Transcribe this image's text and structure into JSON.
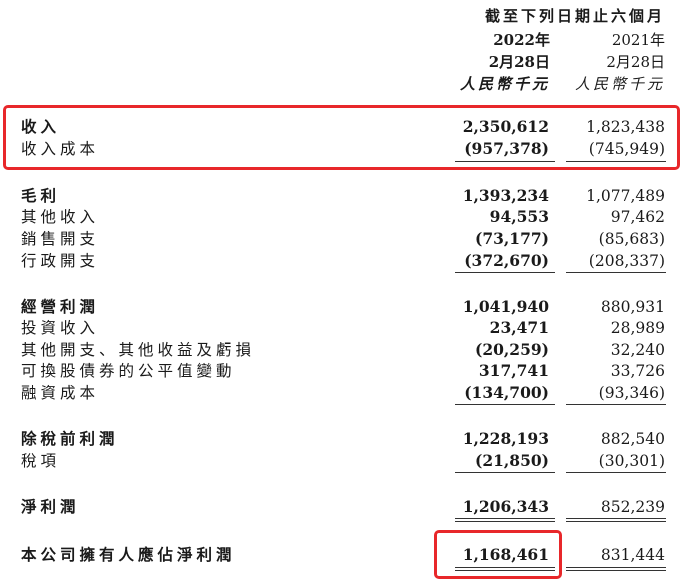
{
  "header": {
    "period": "截至下列日期止六個月",
    "col1": {
      "year": "2022年",
      "date": "2月28日",
      "unit": "人民幣千元"
    },
    "col2": {
      "year": "2021年",
      "date": "2月28日",
      "unit": "人民幣千元"
    }
  },
  "rows": [
    {
      "label": "收入",
      "v1": "2,350,612",
      "v2": "1,823,438",
      "bold": true
    },
    {
      "label": "收入成本",
      "v1": "(957,378)",
      "v2": "(745,949)"
    },
    {
      "label": "毛利",
      "v1": "1,393,234",
      "v2": "1,077,489",
      "bold": true
    },
    {
      "label": "其他收入",
      "v1": "94,553",
      "v2": "97,462"
    },
    {
      "label": "銷售開支",
      "v1": "(73,177)",
      "v2": "(85,683)"
    },
    {
      "label": "行政開支",
      "v1": "(372,670)",
      "v2": "(208,337)"
    },
    {
      "label": "經營利潤",
      "v1": "1,041,940",
      "v2": "880,931",
      "bold": true
    },
    {
      "label": "投資收入",
      "v1": "23,471",
      "v2": "28,989"
    },
    {
      "label": "其他開支、其他收益及虧損",
      "v1": "(20,259)",
      "v2": "32,240"
    },
    {
      "label": "可換股債券的公平值變動",
      "v1": "317,741",
      "v2": "33,726"
    },
    {
      "label": "融資成本",
      "v1": "(134,700)",
      "v2": "(93,346)"
    },
    {
      "label": "除稅前利潤",
      "v1": "1,228,193",
      "v2": "882,540",
      "bold": true
    },
    {
      "label": "稅項",
      "v1": "(21,850)",
      "v2": "(30,301)"
    },
    {
      "label": "淨利潤",
      "v1": "1,206,343",
      "v2": "852,239",
      "bold": true
    },
    {
      "label": "本公司擁有人應佔淨利潤",
      "v1": "1,168,461",
      "v2": "831,444",
      "bold": true
    }
  ],
  "highlight_color": "#e8272a"
}
